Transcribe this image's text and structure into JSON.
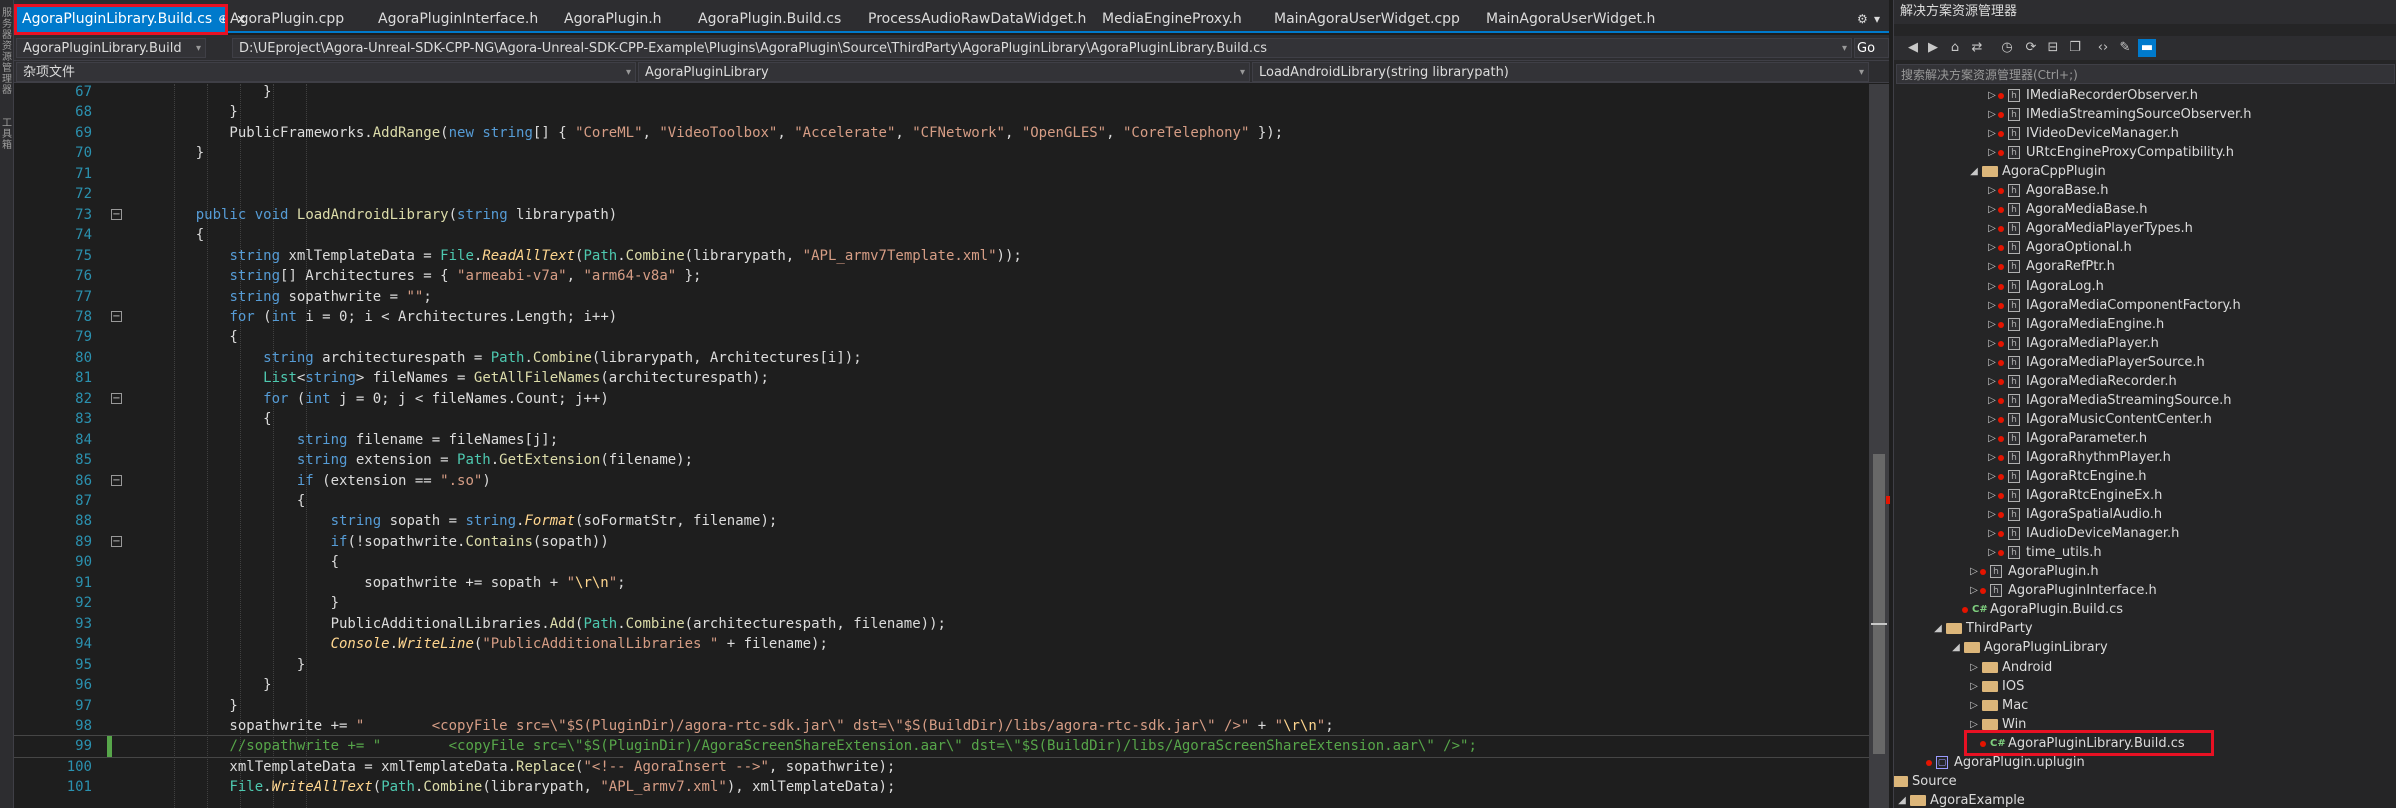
{
  "left_strip": {
    "labels": [
      "服务器资源管理器",
      "工具箱"
    ]
  },
  "tabs": [
    {
      "label": "AgoraPluginLibrary.Build.cs",
      "active": true
    },
    {
      "label": "AgoraPlugin.cpp"
    },
    {
      "label": "AgoraPluginInterface.h"
    },
    {
      "label": "AgoraPlugin.h"
    },
    {
      "label": "AgoraPlugin.Build.cs"
    },
    {
      "label": "ProcessAudioRawDataWidget.h"
    },
    {
      "label": "MediaEngineProxy.h"
    },
    {
      "label": "MainAgoraUserWidget.cpp"
    },
    {
      "label": "MainAgoraUserWidget.h"
    }
  ],
  "tab_buttons": {
    "pin": "⊕",
    "close": "×",
    "settings": "⚙",
    "dropdown": "▾"
  },
  "navbar": {
    "project": "AgoraPluginLibrary.Build",
    "path": "D:\\UEproject\\Agora-Unreal-SDK-CPP-NG\\Agora-Unreal-SDK-CPP-Example\\Plugins\\AgoraPlugin\\Source\\ThirdParty\\AgoraPluginLibrary\\AgoraPluginLibrary.Build.cs",
    "go_label": "Go"
  },
  "combobar": {
    "misc_files": "杂项文件",
    "class_scope": "AgoraPluginLibrary",
    "member_scope": "LoadAndroidLibrary(string librarypath)"
  },
  "code_lines": [
    {
      "n": "67",
      "html": "            <span class=\"pr\">}</span>"
    },
    {
      "n": "68",
      "html": "        }"
    },
    {
      "n": "69",
      "html": "        PublicFrameworks.<span class=\"fn\">AddRange</span>(<span class=\"kw\">new</span> <span class=\"kw\">string</span>[] { <span class=\"st\">\"CoreML\"</span>, <span class=\"st\">\"VideoToolbox\"</span>, <span class=\"st\">\"Accelerate\"</span>, <span class=\"st\">\"CFNetwork\"</span>, <span class=\"st\">\"OpenGLES\"</span>, <span class=\"st\">\"CoreTelephony\"</span> });"
    },
    {
      "n": "70",
      "html": "    }"
    },
    {
      "n": "71",
      "html": ""
    },
    {
      "n": "72",
      "html": ""
    },
    {
      "n": "73",
      "html": "    <span class=\"kw\">public</span> <span class=\"kw\">void</span> <span class=\"fn\">LoadAndroidLibrary</span>(<span class=\"kw\">string</span> librarypath)",
      "fold": "−"
    },
    {
      "n": "74",
      "html": "    {"
    },
    {
      "n": "75",
      "html": "        <span class=\"kw\">string</span> xmlTemplateData = <span class=\"ty\">File</span>.<span class=\"it\">ReadAllText</span>(<span class=\"ty\">Path</span>.<span class=\"fn\">Combine</span>(librarypath, <span class=\"st\">\"APL_armv7Template.xml\"</span>));"
    },
    {
      "n": "76",
      "html": "        <span class=\"kw\">string</span>[] Architectures = { <span class=\"st\">\"armeabi-v7a\"</span>, <span class=\"st\">\"arm64-v8a\"</span> };"
    },
    {
      "n": "77",
      "html": "        <span class=\"kw\">string</span> sopathwrite = <span class=\"st\">\"\"</span>;"
    },
    {
      "n": "78",
      "html": "        <span class=\"kw\">for</span> (<span class=\"kw\">int</span> i = 0; i &lt; Architectures.Length; i++)",
      "fold": "−"
    },
    {
      "n": "79",
      "html": "        {"
    },
    {
      "n": "80",
      "html": "            <span class=\"kw\">string</span> architecturespath = <span class=\"ty\">Path</span>.<span class=\"fn\">Combine</span>(librarypath, Architectures[i]);"
    },
    {
      "n": "81",
      "html": "            <span class=\"ty\">List</span>&lt;<span class=\"kw\">string</span>&gt; fileNames = <span class=\"fn\">GetAllFileNames</span>(architecturespath);"
    },
    {
      "n": "82",
      "html": "            <span class=\"kw\">for</span> (<span class=\"kw\">int</span> j = 0; j &lt; fileNames.Count; j++)",
      "fold": "−"
    },
    {
      "n": "83",
      "html": "            {"
    },
    {
      "n": "84",
      "html": "                <span class=\"kw\">string</span> filename = fileNames[j];"
    },
    {
      "n": "85",
      "html": "                <span class=\"kw\">string</span> extension = <span class=\"ty\">Path</span>.<span class=\"fn\">GetExtension</span>(filename);"
    },
    {
      "n": "86",
      "html": "                <span class=\"kw\">if</span> (extension == <span class=\"st\">\".so\"</span>)",
      "fold": "−"
    },
    {
      "n": "87",
      "html": "                {"
    },
    {
      "n": "88",
      "html": "                    <span class=\"kw\">string</span> sopath = <span class=\"kw\">string</span>.<span class=\"it\">Format</span>(soFormatStr, filename);"
    },
    {
      "n": "89",
      "html": "                    <span class=\"kw\">if</span>(!sopathwrite.<span class=\"fn\">Contains</span>(sopath))",
      "fold": "−"
    },
    {
      "n": "90",
      "html": "                    {"
    },
    {
      "n": "91",
      "html": "                        sopathwrite += sopath + <span class=\"st\">\"</span><span class=\"es\">\\r\\n</span><span class=\"st\">\"</span>;"
    },
    {
      "n": "92",
      "html": "                    }"
    },
    {
      "n": "93",
      "html": "                    PublicAdditionalLibraries.<span class=\"fn\">Add</span>(<span class=\"ty\">Path</span>.<span class=\"fn\">Combine</span>(architecturespath, filename));"
    },
    {
      "n": "94",
      "html": "                    <span class=\"it\">Console</span>.<span class=\"it\">WriteLine</span>(<span class=\"st\">\"PublicAdditionalLibraries \"</span> + filename);"
    },
    {
      "n": "95",
      "html": "                }"
    },
    {
      "n": "96",
      "html": "            }"
    },
    {
      "n": "97",
      "html": "        }"
    },
    {
      "n": "98",
      "html": "        sopathwrite += <span class=\"st\">\"        &lt;copyFile src=\\\"$S(PluginDir)/agora-rtc-sdk.jar\\\" dst=\\\"$S(BuildDir)/libs/agora-rtc-sdk.jar\\\" /&gt;\"</span> + <span class=\"st\">\"</span><span class=\"es\">\\r\\n</span><span class=\"st\">\"</span>;"
    },
    {
      "n": "99",
      "html": "        <span class=\"cm\">//sopathwrite += \"        &lt;copyFile src=\\\"$S(PluginDir)/AgoraScreenShareExtension.aar\\\" dst=\\\"$S(BuildDir)/libs/AgoraScreenShareExtension.aar\\\" /&gt;\";</span>",
      "current": true,
      "changed": true
    },
    {
      "n": "100",
      "html": "        xmlTemplateData = xmlTemplateData.<span class=\"fn\">Replace</span>(<span class=\"st\">\"&lt;!-- AgoraInsert --&gt;\"</span>, sopathwrite);"
    },
    {
      "n": "101",
      "html": "        <span class=\"ty\">File</span>.<span class=\"it\">WriteAllText</span>(<span class=\"ty\">Path</span>.<span class=\"fn\">Combine</span>(librarypath, <span class=\"st\">\"APL_armv7.xml\"</span>), xmlTemplateData);"
    }
  ],
  "solution_explorer": {
    "title": "解决方案资源管理器",
    "search_placeholder": "搜索解决方案资源管理器(Ctrl+;)",
    "toolbar_icons": [
      "back-icon",
      "forward-icon",
      "home-icon",
      "switch-view-icon",
      "history-icon",
      "sync-icon",
      "collapse-icon",
      "copy-icon",
      "code-view-icon",
      "properties-icon",
      "preview-icon"
    ],
    "items": [
      {
        "label": "IMediaRecorderObserver.h",
        "level": 8,
        "type": "h",
        "exp": "▷",
        "dot": true
      },
      {
        "label": "IMediaStreamingSourceObserver.h",
        "level": 8,
        "type": "h",
        "exp": "▷",
        "dot": true
      },
      {
        "label": "IVideoDeviceManager.h",
        "level": 8,
        "type": "h",
        "exp": "▷",
        "dot": true
      },
      {
        "label": "URtcEngineProxyCompatibility.h",
        "level": 8,
        "type": "h",
        "exp": "▷",
        "dot": true
      },
      {
        "label": "AgoraCppPlugin",
        "level": 7,
        "type": "folder",
        "exp": "◢"
      },
      {
        "label": "AgoraBase.h",
        "level": 8,
        "type": "h",
        "exp": "▷",
        "dot": true
      },
      {
        "label": "AgoraMediaBase.h",
        "level": 8,
        "type": "h",
        "exp": "▷",
        "dot": true
      },
      {
        "label": "AgoraMediaPlayerTypes.h",
        "level": 8,
        "type": "h",
        "exp": "▷",
        "dot": true
      },
      {
        "label": "AgoraOptional.h",
        "level": 8,
        "type": "h",
        "exp": "▷",
        "dot": true
      },
      {
        "label": "AgoraRefPtr.h",
        "level": 8,
        "type": "h",
        "exp": "▷",
        "dot": true
      },
      {
        "label": "IAgoraLog.h",
        "level": 8,
        "type": "h",
        "exp": "▷",
        "dot": true
      },
      {
        "label": "IAgoraMediaComponentFactory.h",
        "level": 8,
        "type": "h",
        "exp": "▷",
        "dot": true
      },
      {
        "label": "IAgoraMediaEngine.h",
        "level": 8,
        "type": "h",
        "exp": "▷",
        "dot": true
      },
      {
        "label": "IAgoraMediaPlayer.h",
        "level": 8,
        "type": "h",
        "exp": "▷",
        "dot": true
      },
      {
        "label": "IAgoraMediaPlayerSource.h",
        "level": 8,
        "type": "h",
        "exp": "▷",
        "dot": true
      },
      {
        "label": "IAgoraMediaRecorder.h",
        "level": 8,
        "type": "h",
        "exp": "▷",
        "dot": true
      },
      {
        "label": "IAgoraMediaStreamingSource.h",
        "level": 8,
        "type": "h",
        "exp": "▷",
        "dot": true
      },
      {
        "label": "IAgoraMusicContentCenter.h",
        "level": 8,
        "type": "h",
        "exp": "▷",
        "dot": true
      },
      {
        "label": "IAgoraParameter.h",
        "level": 8,
        "type": "h",
        "exp": "▷",
        "dot": true
      },
      {
        "label": "IAgoraRhythmPlayer.h",
        "level": 8,
        "type": "h",
        "exp": "▷",
        "dot": true
      },
      {
        "label": "IAgoraRtcEngine.h",
        "level": 8,
        "type": "h",
        "exp": "▷",
        "dot": true
      },
      {
        "label": "IAgoraRtcEngineEx.h",
        "level": 8,
        "type": "h",
        "exp": "▷",
        "dot": true
      },
      {
        "label": "IAgoraSpatialAudio.h",
        "level": 8,
        "type": "h",
        "exp": "▷",
        "dot": true
      },
      {
        "label": "IAudioDeviceManager.h",
        "level": 8,
        "type": "h",
        "exp": "▷",
        "dot": true
      },
      {
        "label": "time_utils.h",
        "level": 8,
        "type": "h",
        "exp": "▷",
        "dot": true
      },
      {
        "label": "AgoraPlugin.h",
        "level": 7,
        "type": "h",
        "exp": "▷",
        "dot": true
      },
      {
        "label": "AgoraPluginInterface.h",
        "level": 7,
        "type": "h",
        "exp": "▷",
        "dot": true
      },
      {
        "label": "AgoraPlugin.Build.cs",
        "level": 6,
        "type": "cs",
        "exp": "",
        "dot": true
      },
      {
        "label": "ThirdParty",
        "level": 5,
        "type": "folder",
        "exp": "◢"
      },
      {
        "label": "AgoraPluginLibrary",
        "level": 6,
        "type": "folder",
        "exp": "◢"
      },
      {
        "label": "Android",
        "level": 7,
        "type": "folder",
        "exp": "▷"
      },
      {
        "label": "IOS",
        "level": 7,
        "type": "folder",
        "exp": "▷"
      },
      {
        "label": "Mac",
        "level": 7,
        "type": "folder",
        "exp": "▷"
      },
      {
        "label": "Win",
        "level": 7,
        "type": "folder",
        "exp": "▷"
      },
      {
        "label": "AgoraPluginLibrary.Build.cs",
        "level": 7,
        "type": "cs",
        "exp": "",
        "dot": true,
        "highlight": true
      },
      {
        "label": "AgoraPlugin.uplugin",
        "level": 4,
        "type": "proj",
        "exp": "",
        "dot": true
      },
      {
        "label": "Source",
        "level": 2,
        "type": "folder",
        "exp": "◢"
      },
      {
        "label": "AgoraExample",
        "level": 3,
        "type": "folder",
        "exp": "◢"
      }
    ]
  },
  "colors": {
    "accent": "#007acc",
    "highlight_box": "#e81123",
    "line_number": "#2b91af",
    "keyword": "#569cd6",
    "string": "#d69d85",
    "comment": "#57a64a"
  }
}
